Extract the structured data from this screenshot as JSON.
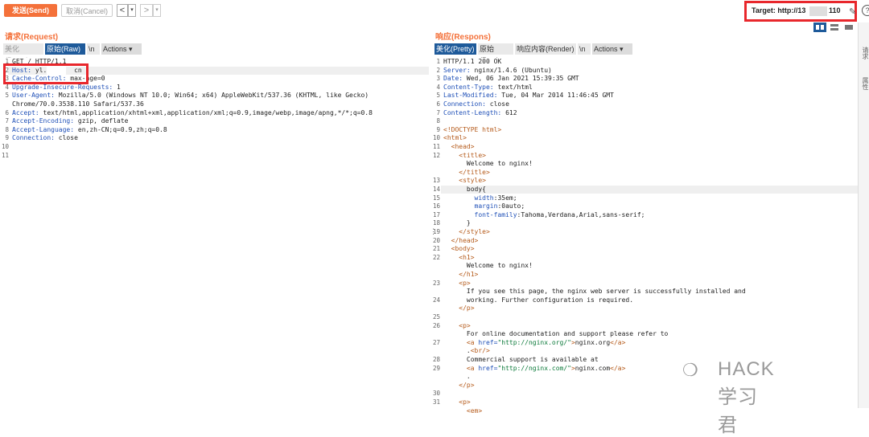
{
  "toolbar": {
    "send_label": "发送(Send)",
    "cancel_label": "取消(Cancel)",
    "prev_label": "<",
    "prev_dropdown": "▾",
    "next_label": ">",
    "next_dropdown": "▾",
    "target_prefix": "Target: http://13",
    "target_suffix": "110",
    "edit_icon": "pencil-icon",
    "help_label": "?"
  },
  "request": {
    "title": "请求(Request)",
    "tabs": [
      "美化(Pretty)",
      "原始(Raw)",
      "\\n",
      "Actions ▾"
    ],
    "active_tab": "原始(Raw)",
    "lines": [
      {
        "n": "1",
        "text": "GET / HTTP/1.1"
      },
      {
        "n": "2",
        "key": "Host:",
        "val": " yl.,      cn"
      },
      {
        "n": "3",
        "key": "Cache-Control:",
        "val": " max-age=0"
      },
      {
        "n": "4",
        "key": "Upgrade-Insecure-Requests:",
        "val": " 1"
      },
      {
        "n": "5",
        "key": "User-Agent:",
        "val": " Mozilla/5.0 (Windows NT 10.0; Win64; x64) AppleWebKit/537.36 (KHTML, like Gecko)"
      },
      {
        "n": "",
        "text": "Chrome/70.0.3538.110 Safari/537.36"
      },
      {
        "n": "6",
        "key": "Accept:",
        "val": " text/html,application/xhtml+xml,application/xml;q=0.9,image/webp,image/apng,*/*;q=0.8"
      },
      {
        "n": "7",
        "key": "Accept-Encoding:",
        "val": " gzip, deflate"
      },
      {
        "n": "8",
        "key": "Accept-Language:",
        "val": " en,zh-CN;q=0.9,zh;q=0.8"
      },
      {
        "n": "9",
        "key": "Connection:",
        "val": " close"
      },
      {
        "n": "10",
        "text": ""
      },
      {
        "n": "11",
        "text": ""
      }
    ]
  },
  "response": {
    "title": "响应(Respons)",
    "tabs": [
      "美化(Pretty)",
      "原始(Raw)",
      "响应内容(Render)",
      "\\n",
      "Actions ▾"
    ],
    "active_tab": "美化(Pretty)",
    "lines": [
      {
        "n": "1",
        "text": "HTTP/1.1 200 OK"
      },
      {
        "n": "2",
        "key": "Server:",
        "val": " nginx/1.4.6 (Ubuntu)"
      },
      {
        "n": "3",
        "key": "Date:",
        "val": " Wed, 06 Jan 2021 15:39:35 GMT"
      },
      {
        "n": "4",
        "key": "Content-Type:",
        "val": " text/html"
      },
      {
        "n": "5",
        "key": "Last-Modified:",
        "val": " Tue, 04 Mar 2014 11:46:45 GMT"
      },
      {
        "n": "6",
        "key": "Connection:",
        "val": " close"
      },
      {
        "n": "7",
        "key": "Content-Length:",
        "val": " 612"
      },
      {
        "n": "8",
        "text": ""
      },
      {
        "n": "9",
        "tag": "<!DOCTYPE html>"
      },
      {
        "n": "10",
        "tag": "<html>"
      },
      {
        "n": "11",
        "indent": "  ",
        "tag": "<head>"
      },
      {
        "n": "12",
        "indent": "    ",
        "tag": "<title>"
      },
      {
        "n": "",
        "indent": "      ",
        "text": "Welcome to nginx!"
      },
      {
        "n": "",
        "indent": "    ",
        "tag": "</title>"
      },
      {
        "n": "13",
        "indent": "    ",
        "tag": "<style>"
      },
      {
        "n": "14",
        "indent": "      ",
        "text": "body{"
      },
      {
        "n": "15",
        "indent": "        ",
        "key": "width",
        "val": ":35em;"
      },
      {
        "n": "16",
        "indent": "        ",
        "key": "margin",
        "val": ":0auto;"
      },
      {
        "n": "17",
        "indent": "        ",
        "key": "font-family",
        "val": ":Tahoma,Verdana,Arial,sans-serif;"
      },
      {
        "n": "18",
        "indent": "      ",
        "text": "}"
      },
      {
        "n": "19",
        "indent": "    ",
        "tag": "</style>"
      },
      {
        "n": "20",
        "indent": "  ",
        "tag": "</head>"
      },
      {
        "n": "21",
        "indent": "  ",
        "tag": "<body>"
      },
      {
        "n": "22",
        "indent": "    ",
        "tag": "<h1>"
      },
      {
        "n": "",
        "indent": "      ",
        "text": "Welcome to nginx!"
      },
      {
        "n": "",
        "indent": "    ",
        "tag": "</h1>"
      },
      {
        "n": "23",
        "indent": "    ",
        "tag": "<p>"
      },
      {
        "n": "",
        "indent": "      ",
        "text": "If you see this page, the nginx web server is successfully installed and"
      },
      {
        "n": "24",
        "indent": "      ",
        "text": "working. Further configuration is required."
      },
      {
        "n": "",
        "indent": "    ",
        "tag": "</p>"
      },
      {
        "n": "25",
        "text": ""
      },
      {
        "n": "26",
        "indent": "    ",
        "tag": "<p>"
      },
      {
        "n": "",
        "indent": "      ",
        "text": "For online documentation and support please refer to"
      },
      {
        "n": "27",
        "indent": "      ",
        "tag": "<a ",
        "attr": "href=",
        "str": "\"http://nginx.org/\"",
        "tail_tag": ">",
        "tail": "nginx.org",
        "close": "</a>"
      },
      {
        "n": "",
        "indent": "      ",
        "text": ".",
        "tag2": "<br/>"
      },
      {
        "n": "28",
        "indent": "      ",
        "text": "Commercial support is available at"
      },
      {
        "n": "29",
        "indent": "      ",
        "tag": "<a ",
        "attr": "href=",
        "str": "\"http://nginx.com/\"",
        "tail_tag": ">",
        "tail": "nginx.com",
        "close": "</a>"
      },
      {
        "n": "",
        "indent": "      ",
        "text": "."
      },
      {
        "n": "",
        "indent": "    ",
        "tag": "</p>"
      },
      {
        "n": "30",
        "text": ""
      },
      {
        "n": "31",
        "indent": "    ",
        "tag": "<p>"
      },
      {
        "n": "",
        "indent": "      ",
        "tag": "<em>"
      }
    ]
  },
  "right_rail": {
    "labels": [
      "请求",
      "属性"
    ]
  },
  "watermark": {
    "icon": "wechat-icon",
    "text": "HACK学习君"
  },
  "colors": {
    "accent": "#f4713a",
    "active_tab": "#1e5a9a",
    "highlight_box": "#e8272c"
  }
}
